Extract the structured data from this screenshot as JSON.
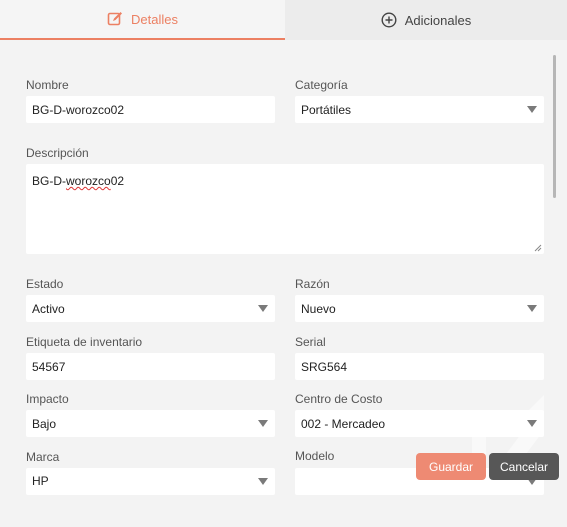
{
  "tabs": [
    {
      "label": "Detalles",
      "icon": "edit-icon"
    },
    {
      "label": "Adicionales",
      "icon": "plus-circle-icon"
    }
  ],
  "form": {
    "nombre": {
      "label": "Nombre",
      "value": "BG-D-worozco02"
    },
    "categoria": {
      "label": "Categoría",
      "value": "Portátiles"
    },
    "descripcion": {
      "label": "Descripción",
      "prefix": "BG-D-",
      "misspelled": "worozco",
      "suffix": "02"
    },
    "estado": {
      "label": "Estado",
      "value": "Activo"
    },
    "razon": {
      "label": "Razón",
      "value": "Nuevo"
    },
    "etiqueta": {
      "label": "Etiqueta de inventario",
      "value": "54567"
    },
    "serial": {
      "label": "Serial",
      "value": "SRG564"
    },
    "impacto": {
      "label": "Impacto",
      "value": "Bajo"
    },
    "centro": {
      "label": "Centro de Costo",
      "value": "002 - Mercadeo"
    },
    "marca": {
      "label": "Marca",
      "value": "HP"
    },
    "modelo": {
      "label": "Modelo",
      "value": ""
    }
  },
  "buttons": {
    "save": "Guardar",
    "cancel": "Cancelar"
  },
  "colors": {
    "accent": "#ec8063",
    "save": "#ee8a73",
    "cancel": "#575757"
  }
}
